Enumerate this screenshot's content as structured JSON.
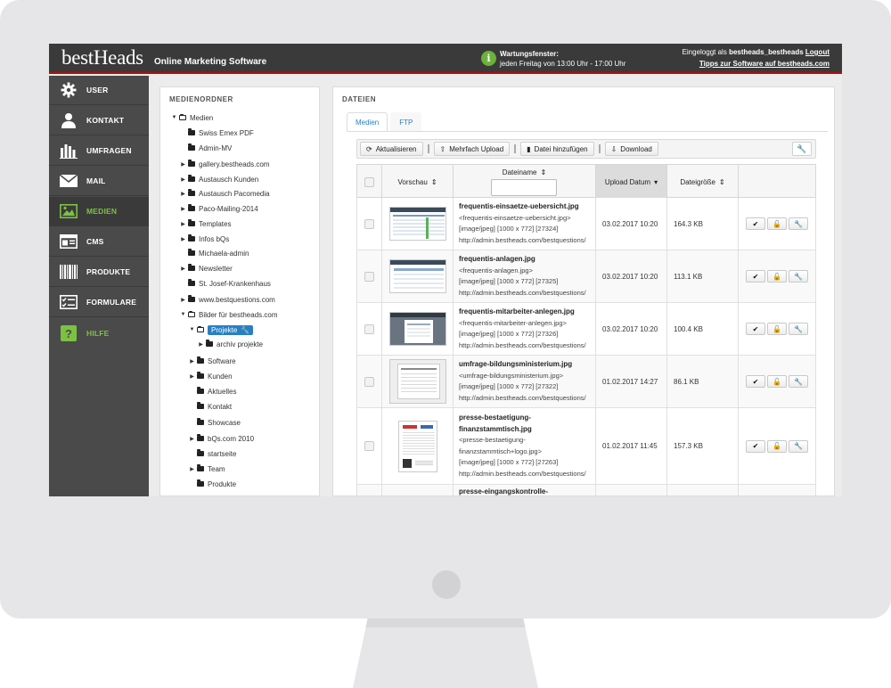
{
  "header": {
    "logo": "bestHeads",
    "tagline": "Online Marketing Software",
    "maintenance_title": "Wartungsfenster:",
    "maintenance_text": "jeden Freitag von 13:00 Uhr - 17:00 Uhr",
    "login_prefix": "Eingeloggt als",
    "login_user": "bestheads_bestheads",
    "logout_label": "Logout",
    "tips_link": "Tipps zur Software auf bestheads.com"
  },
  "nav": {
    "items": [
      {
        "label": "USER",
        "icon": "gear-icon"
      },
      {
        "label": "KONTAKT",
        "icon": "person-icon"
      },
      {
        "label": "UMFRAGEN",
        "icon": "bar-chart-icon"
      },
      {
        "label": "MAIL",
        "icon": "envelope-icon"
      },
      {
        "label": "MEDIEN",
        "icon": "image-icon",
        "active": true
      },
      {
        "label": "CMS",
        "icon": "window-icon"
      },
      {
        "label": "PRODUKTE",
        "icon": "barcode-icon"
      },
      {
        "label": "FORMULARE",
        "icon": "checklist-icon"
      },
      {
        "label": "HILFE",
        "icon": "help-icon"
      }
    ]
  },
  "folders": {
    "title": "MEDIENORDNER",
    "root": "Medien",
    "items": [
      "Swiss Emex PDF",
      "Admin-MV",
      "gallery.bestheads.com",
      "Austausch Kunden",
      "Austausch Pacomedia",
      "Paco-Mailing-2014",
      "Templates",
      "Infos bQs",
      "Michaela-admin",
      "Newsletter",
      "St. Josef-Krankenhaus",
      "www.bestquestions.com",
      "Bilder für bestheads.com"
    ],
    "selected": "Projekte",
    "sub_selected": "archiv projekte",
    "sub_items": [
      "Software",
      "Kunden",
      "Aktuelles",
      "Kontakt",
      "Showcase",
      "bQs.com 2010",
      "startseite",
      "Team",
      "Produkte"
    ]
  },
  "files": {
    "title": "DATEIEN",
    "tabs": [
      "Medien",
      "FTP"
    ],
    "toolbar": {
      "refresh": "Aktualisieren",
      "multi_upload": "Mehrfach Upload",
      "add_file": "Datei hinzufügen",
      "download": "Download"
    },
    "columns": {
      "preview": "Vorschau",
      "filename": "Dateiname",
      "upload_date": "Upload Datum",
      "size": "Dateigröße"
    },
    "rows": [
      {
        "name": "frequentis-einsaetze-uebersicht.jpg",
        "alt": "<frequentis-einsaetze-uebersicht.jpg>",
        "meta": "[image/jpeg] [1000 x 772] [27324]",
        "url": "http://admin.bestheads.com/bestquestions/",
        "date": "03.02.2017 10:20",
        "size": "164.3 KB"
      },
      {
        "name": "frequentis-anlagen.jpg",
        "alt": "<frequentis-anlagen.jpg>",
        "meta": "[image/jpeg] [1000 x 772] [27325]",
        "url": "http://admin.bestheads.com/bestquestions/",
        "date": "03.02.2017 10:20",
        "size": "113.1 KB"
      },
      {
        "name": "frequentis-mitarbeiter-anlegen.jpg",
        "alt": "<frequentis-mitarbeiter-anlegen.jpg>",
        "meta": "[image/jpeg] [1000 x 772] [27326]",
        "url": "http://admin.bestheads.com/bestquestions/",
        "date": "03.02.2017 10:20",
        "size": "100.4 KB"
      },
      {
        "name": "umfrage-bildungsministerium.jpg",
        "alt": "<umfrage-bildungsministerium.jpg>",
        "meta": "[image/jpeg] [1000 x 772] [27322]",
        "url": "http://admin.bestheads.com/bestquestions/",
        "date": "01.02.2017 14:27",
        "size": "86.1 KB"
      },
      {
        "name1": "presse-bestaetigung-",
        "name2": "finanzstammtisch.jpg",
        "alt": "<presse-bestaetigung-",
        "alt2": "finanzstammtisch+logo.jpg>",
        "meta": "[image/jpeg] [1000 x 772] [27263]",
        "url": "http://admin.bestheads.com/bestquestions/",
        "date": "01.02.2017 11:45",
        "size": "157.3 KB"
      },
      {
        "name": "presse-eingangskontrolle-"
      }
    ]
  }
}
